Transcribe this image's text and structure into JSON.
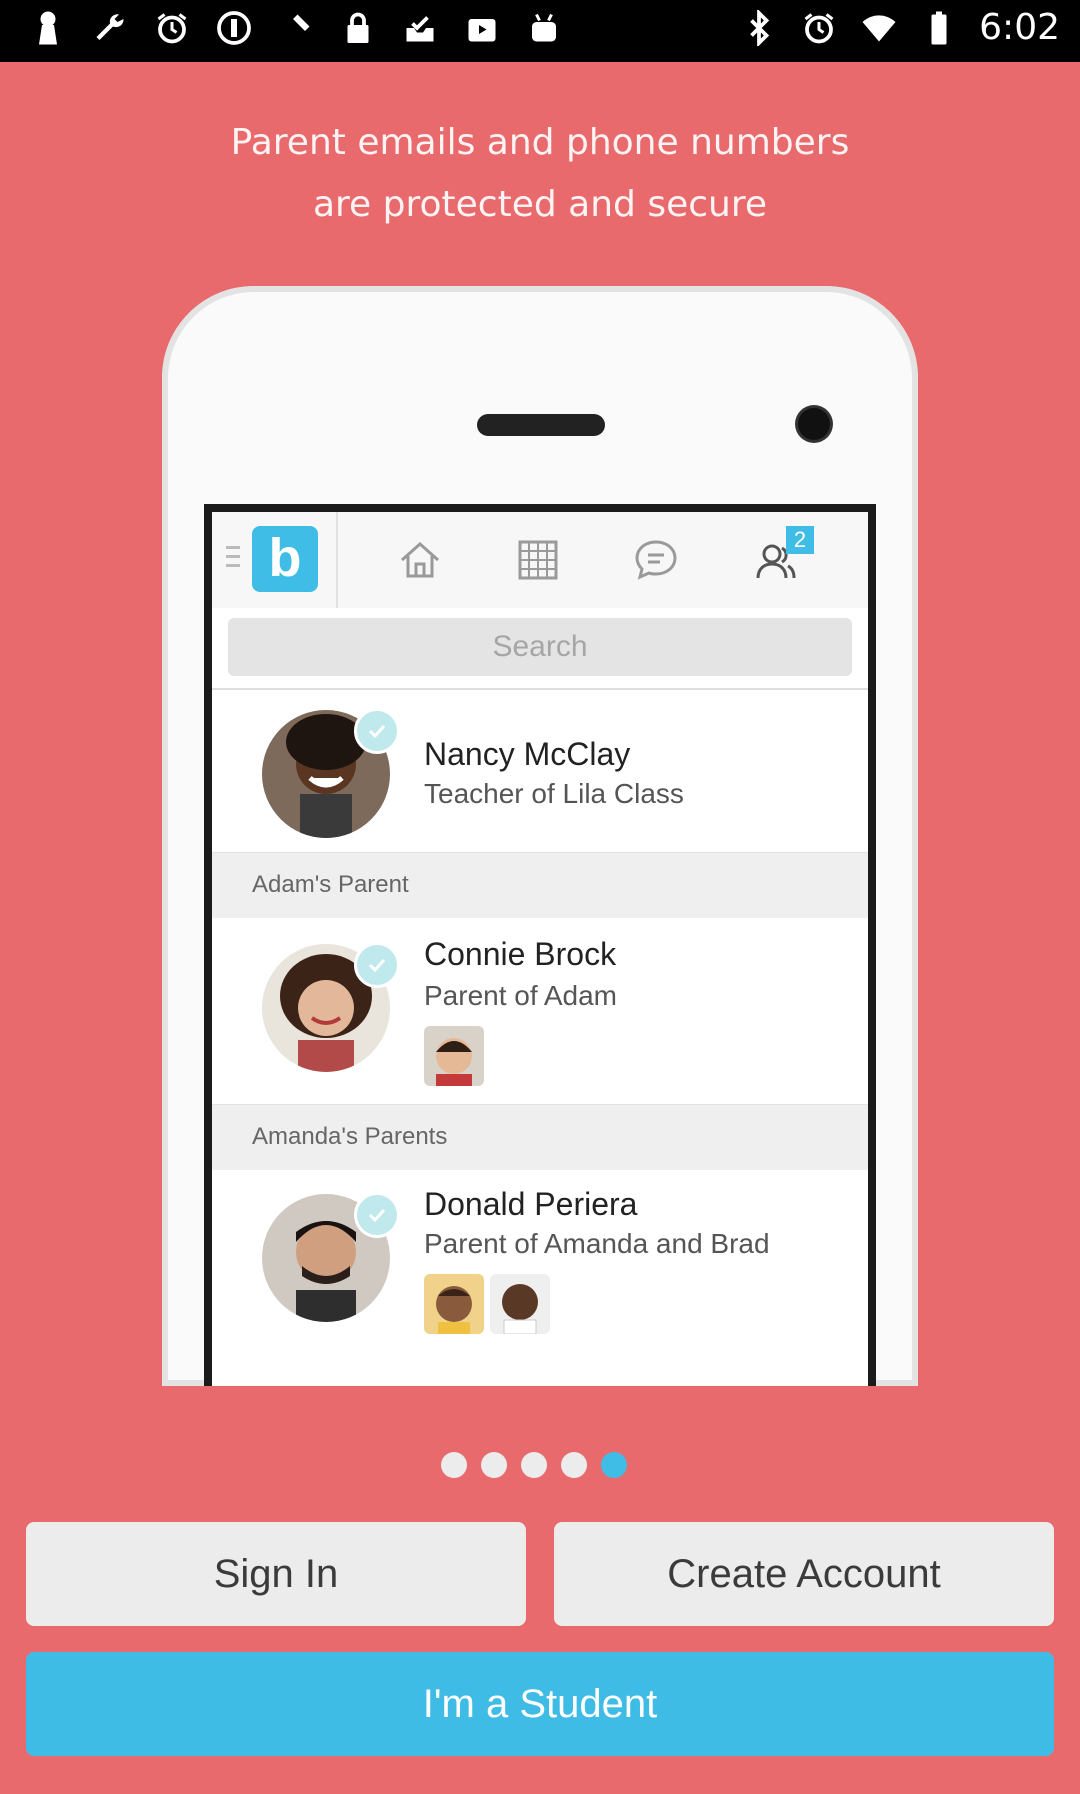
{
  "status_bar": {
    "time": "6:02",
    "left_icons": [
      "keyhole-icon",
      "wrench-icon",
      "alarm-icon",
      "info-icon",
      "satellite-fake-gps-icon",
      "lock-icon",
      "inbox-icon",
      "briefcase-play-icon",
      "android-icon"
    ],
    "right_icons": [
      "bluetooth-icon",
      "alarm-icon",
      "wifi-icon",
      "battery-icon"
    ]
  },
  "headline": {
    "line1": "Parent emails and phone numbers",
    "line2": "are protected and secure"
  },
  "phone_screen": {
    "logo_letter": "b",
    "badge_count": "2",
    "search_placeholder": "Search",
    "contacts": [
      {
        "name": "Nancy McClay",
        "role": "Teacher of Lila Class"
      },
      {
        "name": "Connie Brock",
        "role": "Parent of Adam"
      },
      {
        "name": "Donald Periera",
        "role": "Parent of Amanda and Brad"
      }
    ],
    "sections": [
      "Adam's Parent",
      "Amanda's Parents"
    ]
  },
  "pager": {
    "count": 5,
    "active_index": 4
  },
  "buttons": {
    "sign_in": "Sign In",
    "create_account": "Create Account",
    "student": "I'm a Student"
  },
  "colors": {
    "background": "#e86a6d",
    "accent_blue": "#3fbce6",
    "button_light": "#ececec"
  }
}
